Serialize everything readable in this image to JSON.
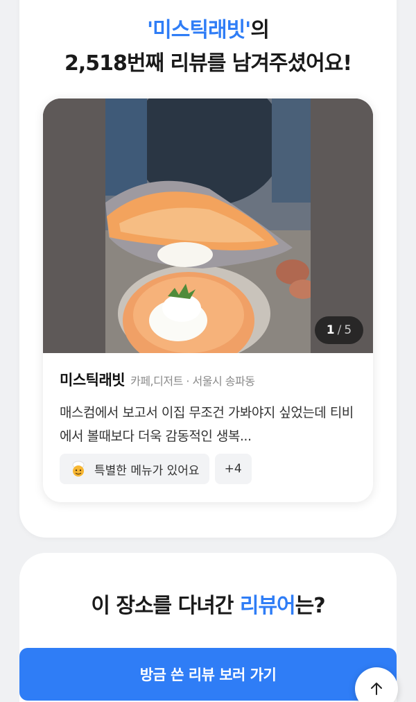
{
  "header": {
    "place_quoted": "'미스틱래빗'",
    "suffix": "의",
    "line2": "2,518번째 리뷰를 남겨주셨어요!"
  },
  "review": {
    "photo_counter_current": "1",
    "photo_counter_sep": "/",
    "photo_counter_total": "5",
    "place_name": "미스틱래빗",
    "place_meta": "카페,디저트 · 서울시 송파동",
    "text": "매스컴에서 보고서 이집 무조건 가봐야지 싶었는데 티비에서 볼때보다 더욱 감동적인 생복...",
    "tags": [
      {
        "label": "특별한 메뉴가 있어요",
        "icon": "chef-icon"
      },
      {
        "label": "+4"
      }
    ]
  },
  "section": {
    "title_pre": "이 장소를 다녀간 ",
    "title_hl": "리뷰어",
    "title_post": "는?"
  },
  "cta": {
    "label": "방금 쓴 리뷰 보러 가기"
  },
  "colors": {
    "accent": "#2f7df6",
    "tag_bg": "#f2f3f5"
  }
}
